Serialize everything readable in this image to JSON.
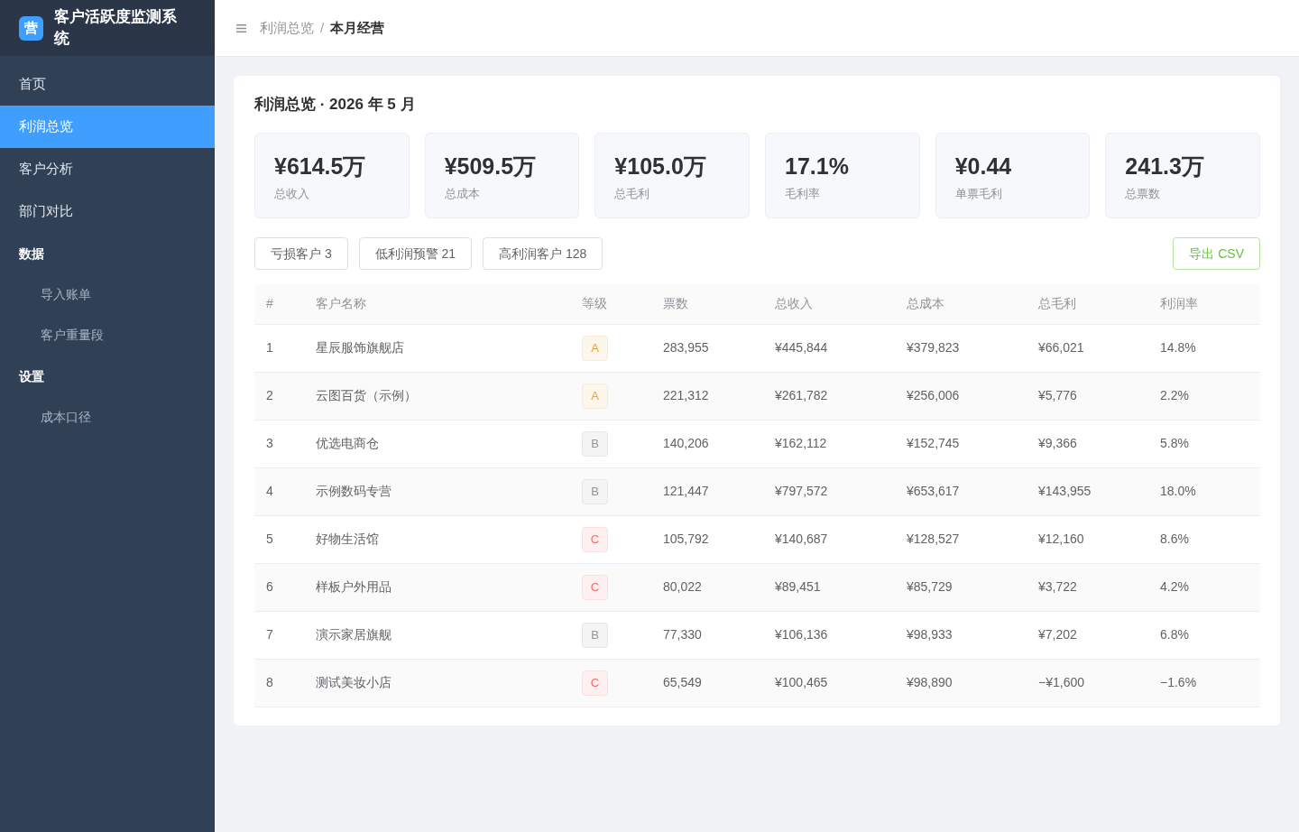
{
  "sidebar": {
    "logo": {
      "mark": "营",
      "title": "客户活跃度监测系统"
    },
    "items": [
      {
        "kind": "link",
        "label": "首页",
        "selected": false
      },
      {
        "kind": "link",
        "label": "利润总览",
        "selected": true
      },
      {
        "kind": "link",
        "label": "客户分析",
        "selected": false
      },
      {
        "kind": "link",
        "label": "部门对比",
        "selected": false
      },
      {
        "kind": "group",
        "label": "数据",
        "children": [
          {
            "label": "导入账单",
            "selected": false
          },
          {
            "label": "客户重量段",
            "selected": false
          }
        ]
      },
      {
        "kind": "group",
        "label": "设置",
        "children": [
          {
            "label": "成本口径",
            "selected": false
          }
        ]
      }
    ]
  },
  "header": {
    "breadcrumb": [
      {
        "label": "利润总览",
        "current": false
      },
      {
        "label": "本月经营",
        "current": true
      }
    ],
    "separator": "/"
  },
  "panel": {
    "title": "利润总览 · 2026 年 5 月",
    "kpis": [
      {
        "value": "¥614.5万",
        "label": "总收入"
      },
      {
        "value": "¥509.5万",
        "label": "总成本"
      },
      {
        "value": "¥105.0万",
        "label": "总毛利"
      },
      {
        "value": "17.1%",
        "label": "毛利率"
      },
      {
        "value": "¥0.44",
        "label": "单票毛利"
      },
      {
        "value": "241.3万",
        "label": "总票数"
      }
    ],
    "filters": [
      "亏损客户 3",
      "低利润预警 21",
      "高利润客户 128"
    ],
    "export_button": "导出 CSV",
    "table": {
      "columns": [
        "#",
        "客户名称",
        "等级",
        "票数",
        "总收入",
        "总成本",
        "总毛利",
        "利润率"
      ],
      "rows": [
        {
          "cells": [
            "1",
            "星辰服饰旗舰店",
            {
              "grade": "A",
              "color": "#e6a23c"
            },
            "283,955",
            "¥445,844",
            "¥379,823",
            "¥66,021",
            "14.8%"
          ]
        },
        {
          "cells": [
            "2",
            "云图百货（示例）",
            {
              "grade": "A",
              "color": "#e6a23c"
            },
            "221,312",
            "¥261,782",
            "¥256,006",
            "¥5,776",
            "2.2%"
          ]
        },
        {
          "cells": [
            "3",
            "优选电商仓",
            {
              "grade": "B",
              "color": "#909399"
            },
            "140,206",
            "¥162,112",
            "¥152,745",
            "¥9,366",
            "5.8%"
          ]
        },
        {
          "cells": [
            "4",
            "示例数码专营",
            {
              "grade": "B",
              "color": "#909399"
            },
            "121,447",
            "¥797,572",
            "¥653,617",
            "¥143,955",
            "18.0%"
          ]
        },
        {
          "cells": [
            "5",
            "好物生活馆",
            {
              "grade": "C",
              "color": "#f56c6c"
            },
            "105,792",
            "¥140,687",
            "¥128,527",
            "¥12,160",
            "8.6%"
          ]
        },
        {
          "cells": [
            "6",
            "样板户外用品",
            {
              "grade": "C",
              "color": "#f56c6c"
            },
            "80,022",
            "¥89,451",
            "¥85,729",
            "¥3,722",
            "4.2%"
          ]
        },
        {
          "cells": [
            "7",
            "演示家居旗舰",
            {
              "grade": "B",
              "color": "#909399"
            },
            "77,330",
            "¥106,136",
            "¥98,933",
            "¥7,202",
            "6.8%"
          ]
        },
        {
          "cells": [
            "8",
            "测试美妆小店",
            {
              "grade": "C",
              "color": "#f56c6c"
            },
            "65,549",
            "¥100,465",
            "¥98,890",
            "−¥1,600",
            "−1.6%"
          ]
        }
      ]
    }
  }
}
